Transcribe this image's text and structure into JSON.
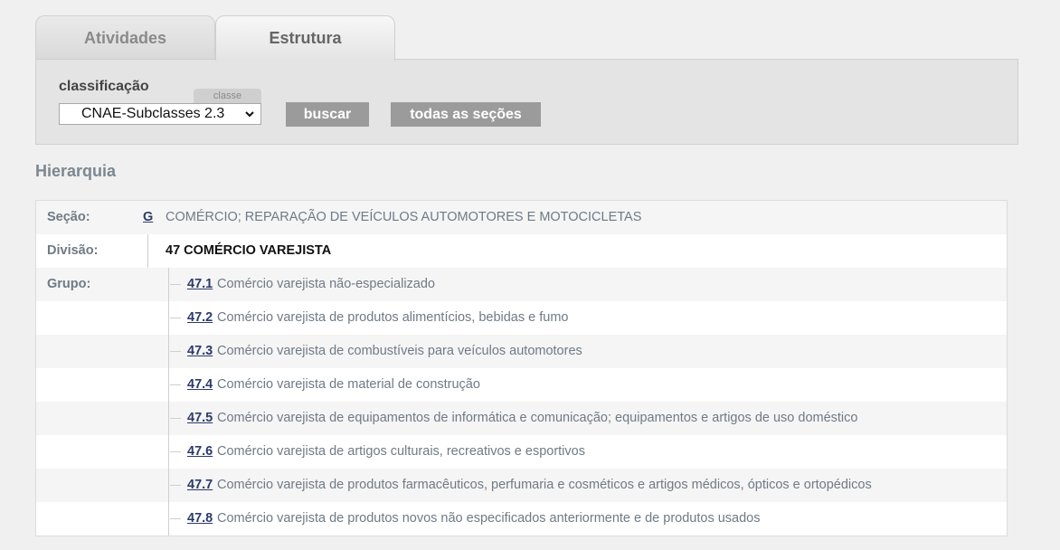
{
  "tabs": [
    {
      "label": "Atividades",
      "active": false
    },
    {
      "label": "Estrutura",
      "active": true
    }
  ],
  "search": {
    "label": "classificação",
    "badge": "classe",
    "select_value": "CNAE-Subclasses 2.3",
    "buscar_label": "buscar",
    "todas_label": "todas as seções"
  },
  "hierarchy": {
    "title": "Hierarquia",
    "secao": {
      "label": "Seção:",
      "code": "G",
      "description": "COMÉRCIO; REPARAÇÃO DE VEÍCULOS AUTOMOTORES E MOTOCICLETAS"
    },
    "divisao": {
      "label": "Divisão:",
      "text": "47 COMÉRCIO VAREJISTA"
    },
    "grupo_label": "Grupo:",
    "grupos": [
      {
        "code": "47.1",
        "description": "Comércio varejista não-especializado"
      },
      {
        "code": "47.2",
        "description": "Comércio varejista de produtos alimentícios, bebidas e fumo"
      },
      {
        "code": "47.3",
        "description": "Comércio varejista de combustíveis para veículos automotores"
      },
      {
        "code": "47.4",
        "description": "Comércio varejista de material de construção"
      },
      {
        "code": "47.5",
        "description": "Comércio varejista de equipamentos de informática e comunicação; equipamentos e artigos de uso doméstico"
      },
      {
        "code": "47.6",
        "description": "Comércio varejista de artigos culturais, recreativos e esportivos"
      },
      {
        "code": "47.7",
        "description": "Comércio varejista de produtos farmacêuticos, perfumaria e cosméticos e artigos médicos, ópticos e ortopédicos"
      },
      {
        "code": "47.8",
        "description": "Comércio varejista de produtos novos não especificados anteriormente e de produtos usados"
      }
    ]
  }
}
